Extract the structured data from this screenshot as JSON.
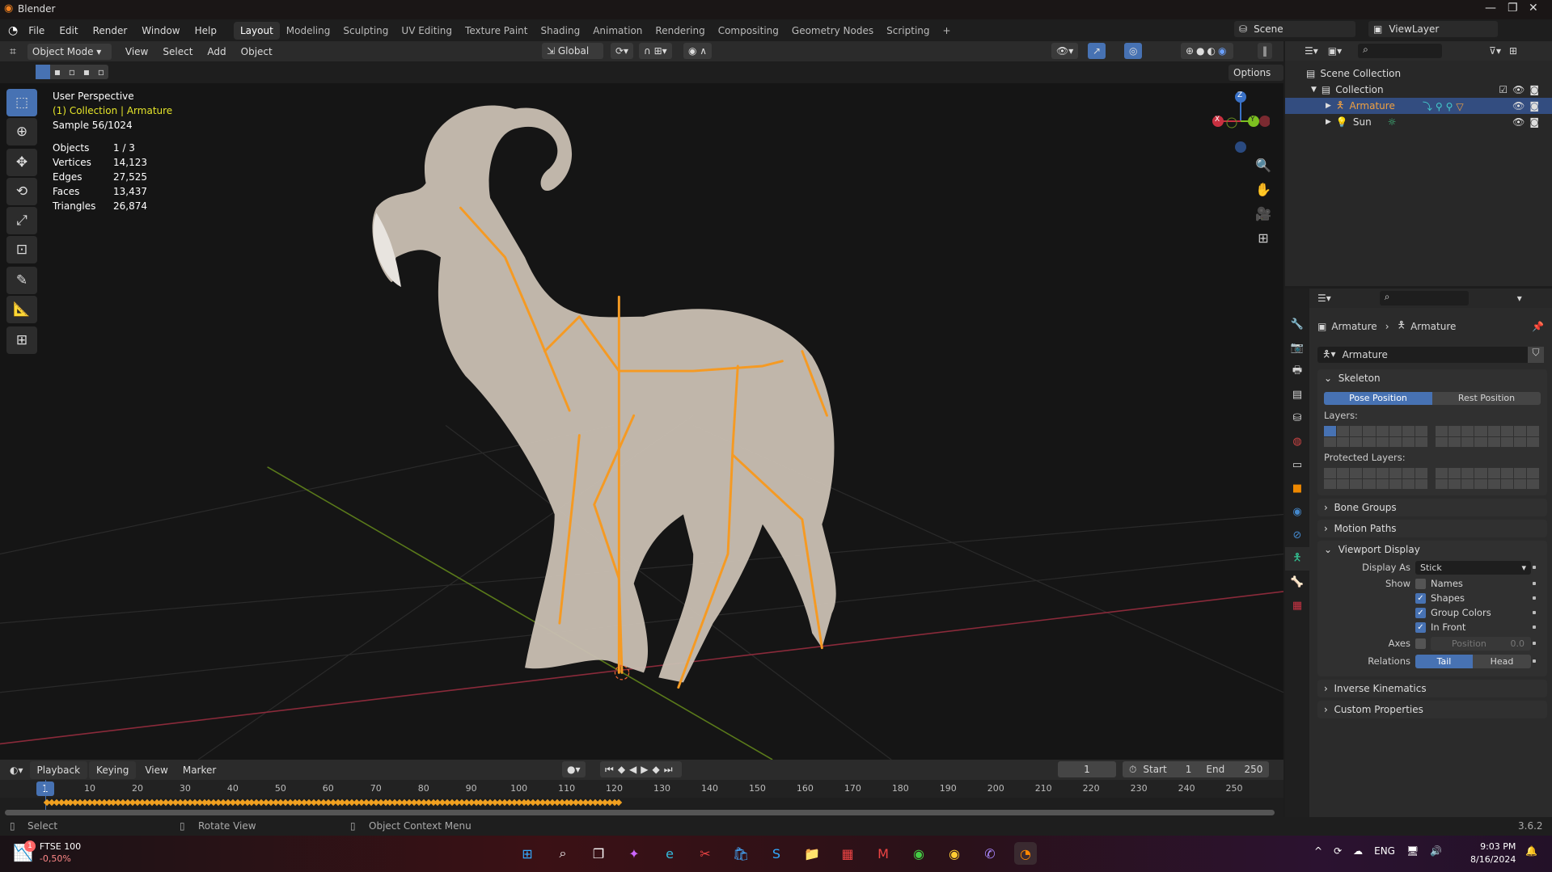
{
  "window": {
    "title": "Blender",
    "controls": [
      "—",
      "❐",
      "✕"
    ]
  },
  "menu": [
    "File",
    "Edit",
    "Render",
    "Window",
    "Help"
  ],
  "workspaces": [
    "Layout",
    "Modeling",
    "Sculpting",
    "UV Editing",
    "Texture Paint",
    "Shading",
    "Animation",
    "Rendering",
    "Compositing",
    "Geometry Nodes",
    "Scripting",
    "+"
  ],
  "active_workspace": "Layout",
  "scene": {
    "name": "Scene",
    "view_layer": "ViewLayer"
  },
  "viewport_header": {
    "mode": "Object Mode",
    "menus": [
      "View",
      "Select",
      "Add",
      "Object"
    ],
    "orientation": "Global",
    "options": "Options"
  },
  "overlay": {
    "view": "User Perspective",
    "context": "(1) Collection | Armature",
    "sample": "Sample 56/1024",
    "stats": [
      {
        "k": "Objects",
        "v": "1 / 3"
      },
      {
        "k": "Vertices",
        "v": "14,123"
      },
      {
        "k": "Edges",
        "v": "27,525"
      },
      {
        "k": "Faces",
        "v": "13,437"
      },
      {
        "k": "Triangles",
        "v": "26,874"
      }
    ]
  },
  "gizmo": {
    "x": "X",
    "y": "Y",
    "z": "Z"
  },
  "outliner": {
    "root": "Scene Collection",
    "collection": "Collection",
    "items": [
      {
        "name": "Armature",
        "selected": true
      },
      {
        "name": "Sun",
        "selected": false
      }
    ]
  },
  "properties": {
    "breadcrumb": [
      "Armature",
      "Armature"
    ],
    "data_name": "Armature",
    "skeleton": {
      "title": "Skeleton",
      "pose": "Pose Position",
      "rest": "Rest Position",
      "active": "Pose Position",
      "layers": "Layers:",
      "protected": "Protected Layers:"
    },
    "collapsed": [
      "Bone Groups",
      "Motion Paths"
    ],
    "viewport_display": {
      "title": "Viewport Display",
      "display_as_label": "Display As",
      "display_as": "Stick",
      "show_label": "Show",
      "checks": [
        {
          "label": "Names",
          "on": false
        },
        {
          "label": "Shapes",
          "on": true
        },
        {
          "label": "Group Colors",
          "on": true
        },
        {
          "label": "In Front",
          "on": true
        }
      ],
      "axes_label": "Axes",
      "axes_pos_label": "Position",
      "axes_pos": "0.0",
      "relations_label": "Relations",
      "tail": "Tail",
      "head": "Head",
      "relations_active": "Tail"
    },
    "bottom_panels": [
      "Inverse Kinematics",
      "Custom Properties"
    ]
  },
  "timeline": {
    "menus": [
      "Playback",
      "Keying",
      "View",
      "Marker"
    ],
    "current": "1",
    "start_label": "Start",
    "start": "1",
    "end_label": "End",
    "end": "250",
    "ticks": [
      "10",
      "20",
      "30",
      "40",
      "50",
      "60",
      "70",
      "80",
      "90",
      "100",
      "110",
      "120",
      "130",
      "140",
      "150",
      "160",
      "170",
      "180",
      "190",
      "200",
      "210",
      "220",
      "230",
      "240",
      "250"
    ],
    "keyframes_last": 121,
    "keyframe_color": "#f0a020"
  },
  "status": {
    "select": "Select",
    "rotate": "Rotate View",
    "context_menu": "Object Context Menu",
    "version": "3.6.2"
  },
  "taskbar": {
    "widget_title": "FTSE 100",
    "widget_value": "-0,50%",
    "widget_badge": "1",
    "lang": "ENG",
    "time": "9:03 PM",
    "date": "8/16/2024"
  },
  "colors": {
    "accent": "#4772b3",
    "bone": "#f59a23",
    "selected_text": "#f0a040"
  }
}
